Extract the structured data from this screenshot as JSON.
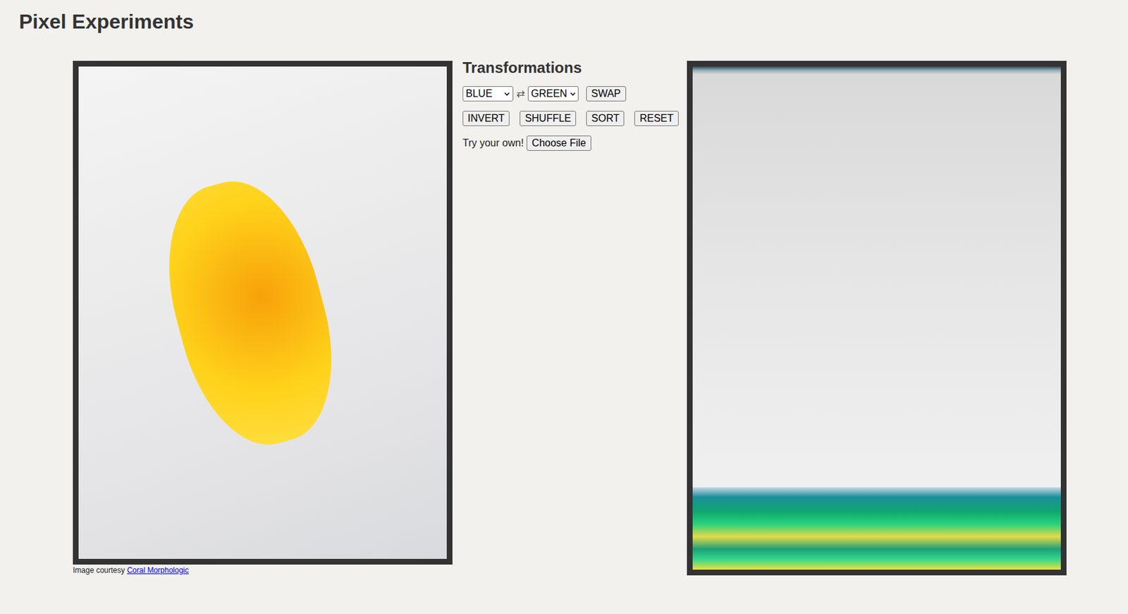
{
  "page": {
    "title": "Pixel Experiments"
  },
  "original": {
    "caption": "Image courtesy ",
    "credit_link": "Coral Morphologic"
  },
  "controls": {
    "heading": "Transformations",
    "swap": {
      "from": "BLUE",
      "arrow": "⇄",
      "to": "GREEN",
      "button": "SWAP"
    },
    "buttons": [
      "INVERT",
      "SHUFFLE",
      "SORT",
      "RESET"
    ],
    "upload": {
      "label": "Try your own!",
      "button": "Choose File"
    }
  }
}
